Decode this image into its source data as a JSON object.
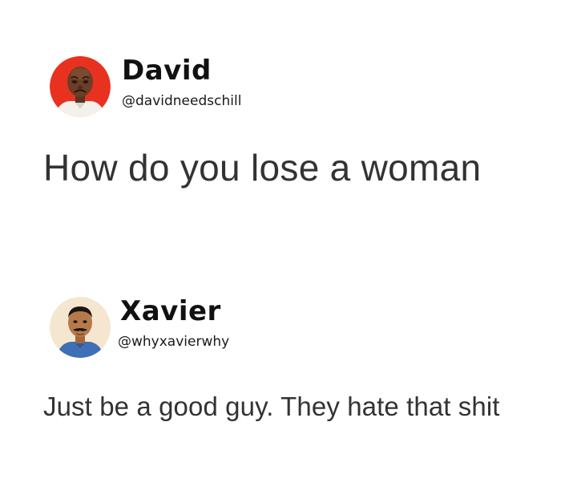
{
  "posts": [
    {
      "display_name": "David",
      "handle": "@davidneedschill",
      "text": "How do you lose a woman",
      "avatar_icon": "crying-man-avatar-icon",
      "avatar_bg": "#e8321f"
    },
    {
      "display_name": "Xavier",
      "handle": "@whyxavierwhy",
      "text": "Just be a good guy. They hate that shit",
      "avatar_icon": "mustache-man-avatar-icon",
      "avatar_bg": "#f5e6cf"
    }
  ]
}
